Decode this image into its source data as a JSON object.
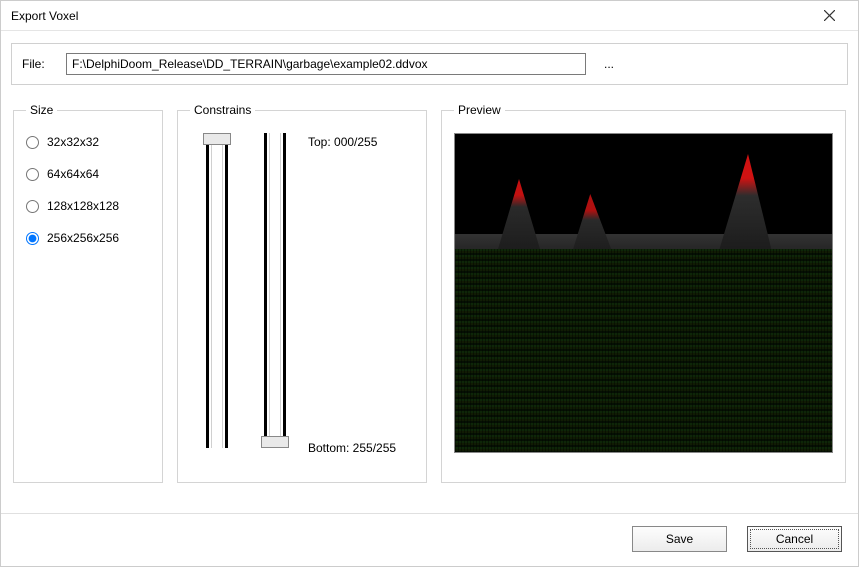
{
  "window": {
    "title": "Export Voxel"
  },
  "file": {
    "label": "File:",
    "value": "F:\\DelphiDoom_Release\\DD_TERRAIN\\garbage\\example02.ddvox",
    "browse_label": "..."
  },
  "size": {
    "legend": "Size",
    "options": [
      {
        "label": "32x32x32",
        "checked": false
      },
      {
        "label": "64x64x64",
        "checked": false
      },
      {
        "label": "128x128x128",
        "checked": false
      },
      {
        "label": "256x256x256",
        "checked": true
      }
    ]
  },
  "constrains": {
    "legend": "Constrains",
    "top_label": "Top: 000/255",
    "bottom_label": "Bottom: 255/255"
  },
  "preview": {
    "legend": "Preview"
  },
  "buttons": {
    "save": "Save",
    "cancel": "Cancel"
  }
}
